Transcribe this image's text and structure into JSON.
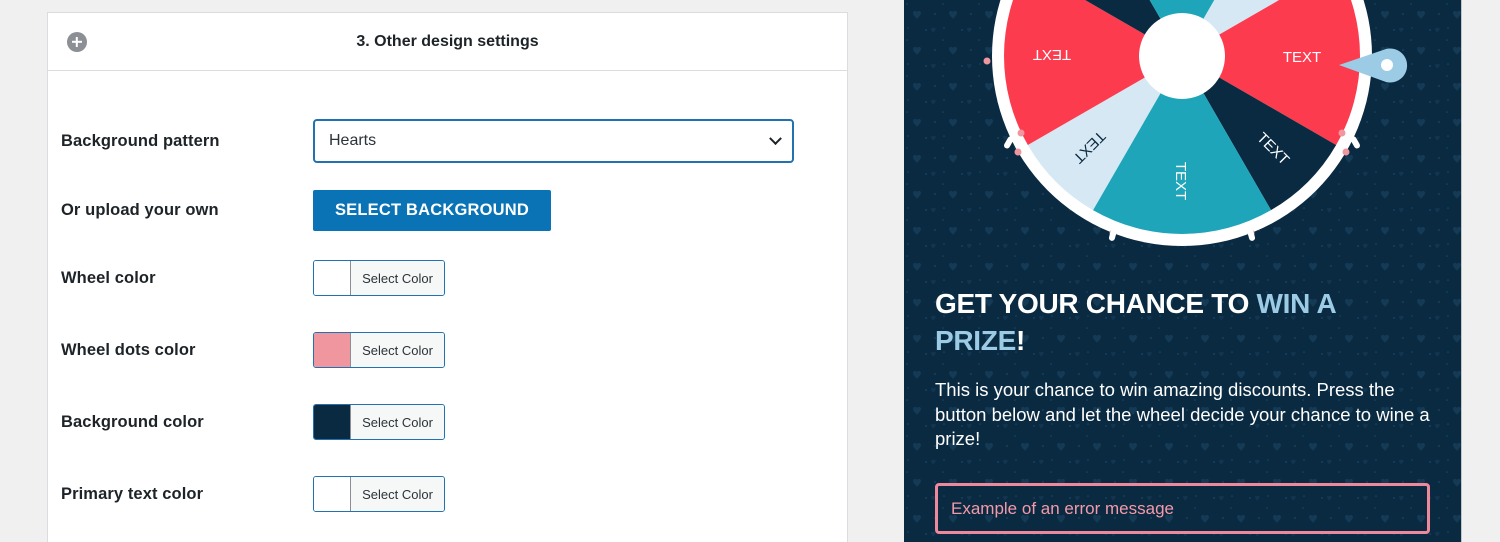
{
  "section": {
    "title": "3. Other design settings"
  },
  "fields": {
    "background_pattern": {
      "label": "Background pattern",
      "value": "Hearts"
    },
    "upload": {
      "label": "Or upload your own",
      "button": "SELECT BACKGROUND"
    },
    "wheel_color": {
      "label": "Wheel color",
      "button": "Select Color",
      "color": "#ffffff"
    },
    "wheel_dots_color": {
      "label": "Wheel dots color",
      "button": "Select Color",
      "color": "#f0969e"
    },
    "background_color": {
      "label": "Background color",
      "button": "Select Color",
      "color": "#0a2a42"
    },
    "primary_text_color": {
      "label": "Primary text color",
      "button": "Select Color",
      "color": "#ffffff"
    }
  },
  "preview": {
    "segment_label": "TEXT",
    "headline_part1": "GET YOUR CHANCE TO ",
    "headline_accent": "WIN A PRIZE",
    "headline_end": "!",
    "body": "This is your chance to win amazing discounts. Press the button below and let the wheel decide your chance to wine a prize!",
    "error_message": "Example of an error message"
  },
  "colors": {
    "accent_blue": "#0a73b5",
    "preview_bg": "#0a2a42",
    "segment_red": "#fc3b4f",
    "segment_light": "#d5e8f3",
    "segment_teal": "#1ea5ba",
    "segment_dark": "#0a2a42",
    "headline_accent": "#9ccbe6",
    "error": "#f0889b"
  }
}
